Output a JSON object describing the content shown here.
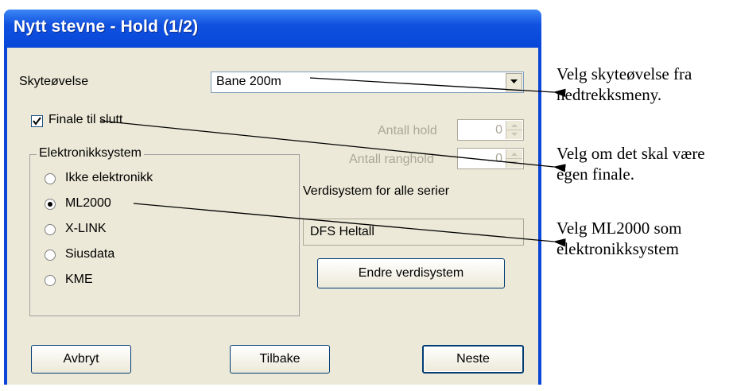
{
  "window": {
    "title": "Nytt stevne - Hold (1/2)"
  },
  "form": {
    "skyteovelse_label": "Skyteøvelse",
    "skyteovelse_value": "Bane 200m",
    "finale_label": "Finale til slutt",
    "finale_checked": true,
    "antall_hold_label": "Antall hold",
    "antall_hold_value": "0",
    "antall_ranghold_label": "Antall ranghold",
    "antall_ranghold_value": "0",
    "elektronikk": {
      "legend": "Elektronikksystem",
      "options": [
        {
          "label": "Ikke elektronikk",
          "selected": false
        },
        {
          "label": "ML2000",
          "selected": true
        },
        {
          "label": "X-LINK",
          "selected": false
        },
        {
          "label": "Siusdata",
          "selected": false
        },
        {
          "label": "KME",
          "selected": false
        }
      ]
    },
    "verdisystem_label": "Verdisystem for alle serier",
    "verdisystem_value": "DFS Heltall",
    "endre_button": "Endre verdisystem"
  },
  "footer": {
    "avbryt": "Avbryt",
    "tilbake": "Tilbake",
    "neste": "Neste"
  },
  "annotations": [
    {
      "line1": "Velg skyteøvelse fra",
      "line2": "nedtrekksmeny."
    },
    {
      "line1": "Velg om det skal være",
      "line2": "egen finale."
    },
    {
      "line1": "Velg ML2000 som",
      "line2": "elektronikksystem"
    }
  ],
  "colors": {
    "title_bar": "#0a47d6",
    "dialog_bg": "#ece9d8"
  }
}
